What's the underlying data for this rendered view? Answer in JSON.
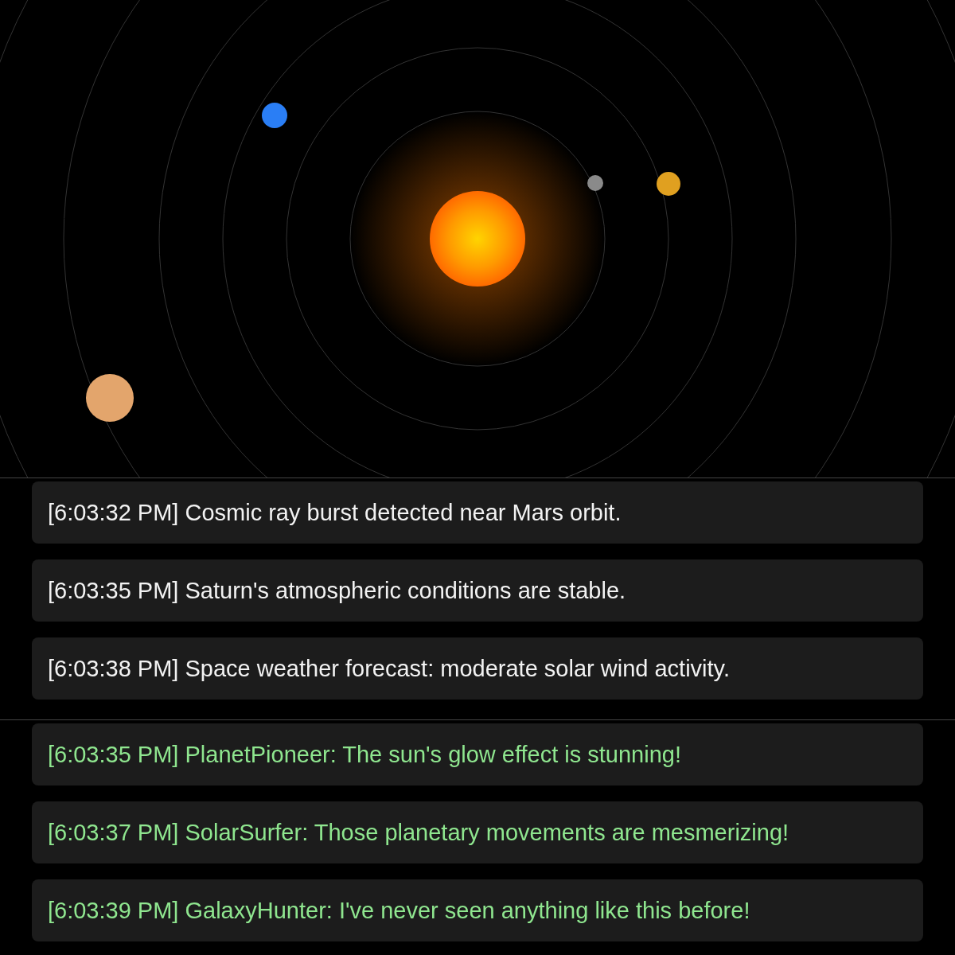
{
  "system_log": {
    "messages": [
      "[6:03:32 PM] Cosmic ray burst detected near Mars orbit.",
      "[6:03:35 PM] Saturn's atmospheric conditions are stable.",
      "[6:03:38 PM] Space weather forecast: moderate solar wind activity."
    ]
  },
  "chat": {
    "messages": [
      "[6:03:35 PM] PlanetPioneer: The sun's glow effect is stunning!",
      "[6:03:37 PM] SolarSurfer: Those planetary movements are mesmerizing!",
      "[6:03:39 PM] GalaxyHunter: I've never seen anything like this before!"
    ]
  }
}
